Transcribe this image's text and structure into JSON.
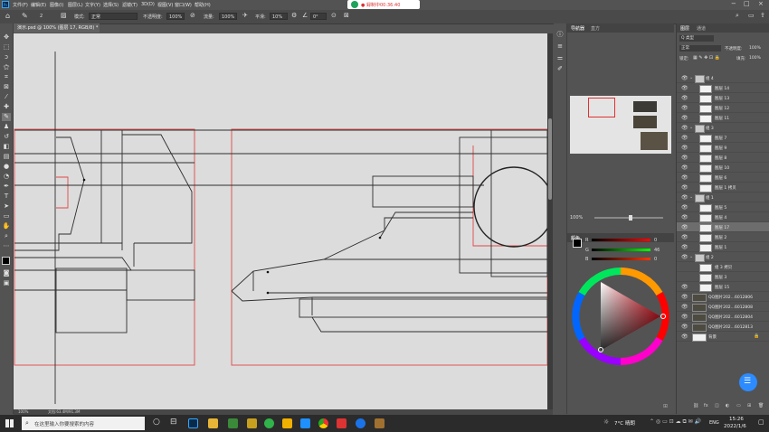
{
  "menubar": {
    "ps_logo": "Ps",
    "items": [
      "文件(F)",
      "编辑(E)",
      "图像(I)",
      "图层(L)",
      "文字(Y)",
      "选择(S)",
      "滤镜(T)",
      "3D(D)",
      "视图(V)",
      "窗口(W)",
      "帮助(H)"
    ],
    "recording": "● 録制中00:36:40"
  },
  "options": {
    "brush_size": "2",
    "mode_label": "模式:",
    "mode_value": "正常",
    "opacity_label": "不透明度:",
    "opacity_value": "100%",
    "flow_label": "流量:",
    "flow_value": "100%",
    "smooth_label": "平滑:",
    "smooth_value": "10%",
    "angle_value": "0°"
  },
  "document": {
    "tab_title": "演示.psd @ 100% (图层 17, RGB/8) *",
    "zoom": "100%",
    "doc_info": "文档:63.4M/91.3M"
  },
  "navigator": {
    "tab_navigator": "导航器",
    "tab_histogram": "直方",
    "zoom": "100%"
  },
  "color": {
    "tab_color": "颜色",
    "r_value": "0",
    "g_value": "0",
    "b_value": "0",
    "r_max": "0",
    "g_max": "46",
    "b_max": "0"
  },
  "layers": {
    "tab_layers": "图层",
    "tab_channels": "通道",
    "kind_label": "Q 类型",
    "blend_value": "正常",
    "opacity_label": "不透明度:",
    "opacity_value": "100%",
    "lock_label": "锁定:",
    "fill_label": "填充:",
    "fill_value": "100%",
    "rows": [
      {
        "name": "组 4",
        "type": "group",
        "depth": 0
      },
      {
        "name": "图层 14",
        "type": "layer",
        "depth": 1
      },
      {
        "name": "图层 13",
        "type": "layer",
        "depth": 1
      },
      {
        "name": "图层 12",
        "type": "layer",
        "depth": 1
      },
      {
        "name": "图层 11",
        "type": "layer",
        "depth": 1
      },
      {
        "name": "组 3",
        "type": "group",
        "depth": 0
      },
      {
        "name": "图层 7",
        "type": "layer",
        "depth": 1
      },
      {
        "name": "图层 9",
        "type": "layer",
        "depth": 1
      },
      {
        "name": "图层 8",
        "type": "layer",
        "depth": 1
      },
      {
        "name": "图层 10",
        "type": "layer",
        "depth": 1
      },
      {
        "name": "图层 6",
        "type": "layer",
        "depth": 1
      },
      {
        "name": "图层 1 拷贝",
        "type": "layer",
        "depth": 1
      },
      {
        "name": "组 1",
        "type": "group",
        "depth": 0
      },
      {
        "name": "图层 5",
        "type": "layer",
        "depth": 1
      },
      {
        "name": "图层 4",
        "type": "layer",
        "depth": 1
      },
      {
        "name": "图层 17",
        "type": "layer",
        "depth": 1,
        "selected": true
      },
      {
        "name": "图层 2",
        "type": "layer",
        "depth": 1
      },
      {
        "name": "图层 1",
        "type": "layer",
        "depth": 1
      },
      {
        "name": "组 2",
        "type": "group",
        "depth": 0
      },
      {
        "name": "组 3 拷贝",
        "type": "layer",
        "depth": 1
      },
      {
        "name": "图层 3",
        "type": "layer",
        "depth": 1
      },
      {
        "name": "图层 15",
        "type": "layer",
        "depth": 1
      },
      {
        "name": "QQ图片202...6012806",
        "type": "image",
        "depth": 0
      },
      {
        "name": "QQ图片202...6012808",
        "type": "image",
        "depth": 0
      },
      {
        "name": "QQ图片202...6012804",
        "type": "image",
        "depth": 0
      },
      {
        "name": "QQ图片202...6012813",
        "type": "image",
        "depth": 0
      },
      {
        "name": "背景",
        "type": "bg",
        "depth": 0
      }
    ]
  },
  "taskbar": {
    "search_placeholder": "在这里输入你要搜索的内容",
    "weather": "7°C 晴朗",
    "lang": "ENG",
    "time": "15:26",
    "date": "2022/1/6"
  }
}
